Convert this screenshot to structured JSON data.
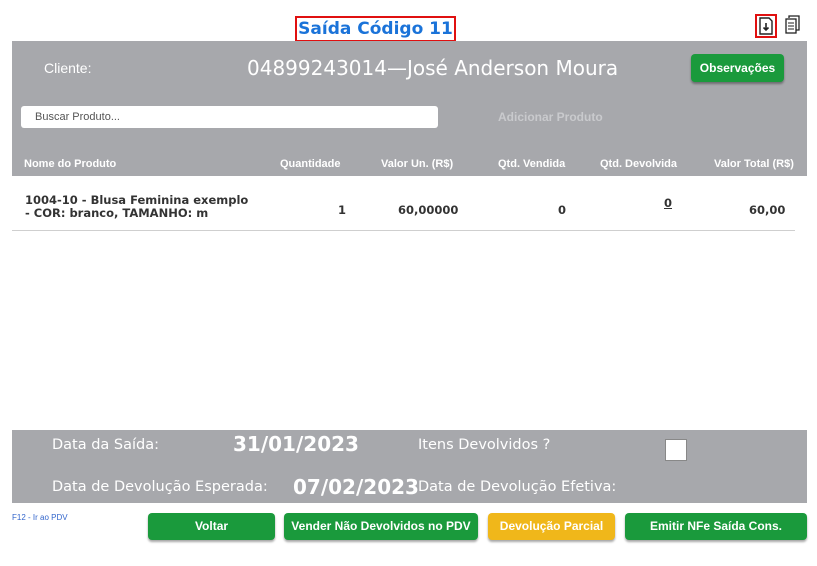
{
  "header": {
    "title": "Saída Código 11"
  },
  "icons": {
    "download": "download-icon",
    "copy": "copy-icon"
  },
  "client": {
    "label": "Cliente:",
    "name": "04899243014—José Anderson Moura",
    "obs_button": "Observações"
  },
  "search": {
    "placeholder": "Buscar Produto...",
    "add_button": "Adicionar Produto"
  },
  "table": {
    "headers": [
      "Nome do Produto",
      "Quantidade",
      "Valor Un. (R$)",
      "Qtd. Vendida",
      "Qtd. Devolvida",
      "Valor Total (R$)"
    ],
    "rows": [
      {
        "name": "1004-10 - Blusa Feminina exemplo - COR: branco, TAMANHO: m",
        "quantidade": "1",
        "valor_un": "60,00000",
        "qtd_vendida": "0",
        "qtd_devolvida": "0",
        "valor_total": "60,00"
      }
    ]
  },
  "footer": {
    "data_saida_label": "Data da Saída:",
    "data_saida": "31/01/2023",
    "itens_devolvidos_label": "Itens Devolvidos ?",
    "data_dev_esperada_label": "Data de Devolução Esperada:",
    "data_dev_esperada": "07/02/2023",
    "data_dev_efetiva_label": "Data de Devolução Efetiva:"
  },
  "actions": {
    "hint": "F12 - Ir ao PDV",
    "voltar": "Voltar",
    "vender": "Vender Não Devolvidos no PDV",
    "devolucao": "Devolução Parcial",
    "emitir": "Emitir NFe Saída Cons."
  },
  "colors": {
    "panel": "#a7a8ac",
    "green": "#1a9a3c",
    "yellow": "#f0b71a",
    "title": "#1a73d9",
    "highlight": "#e01010"
  }
}
